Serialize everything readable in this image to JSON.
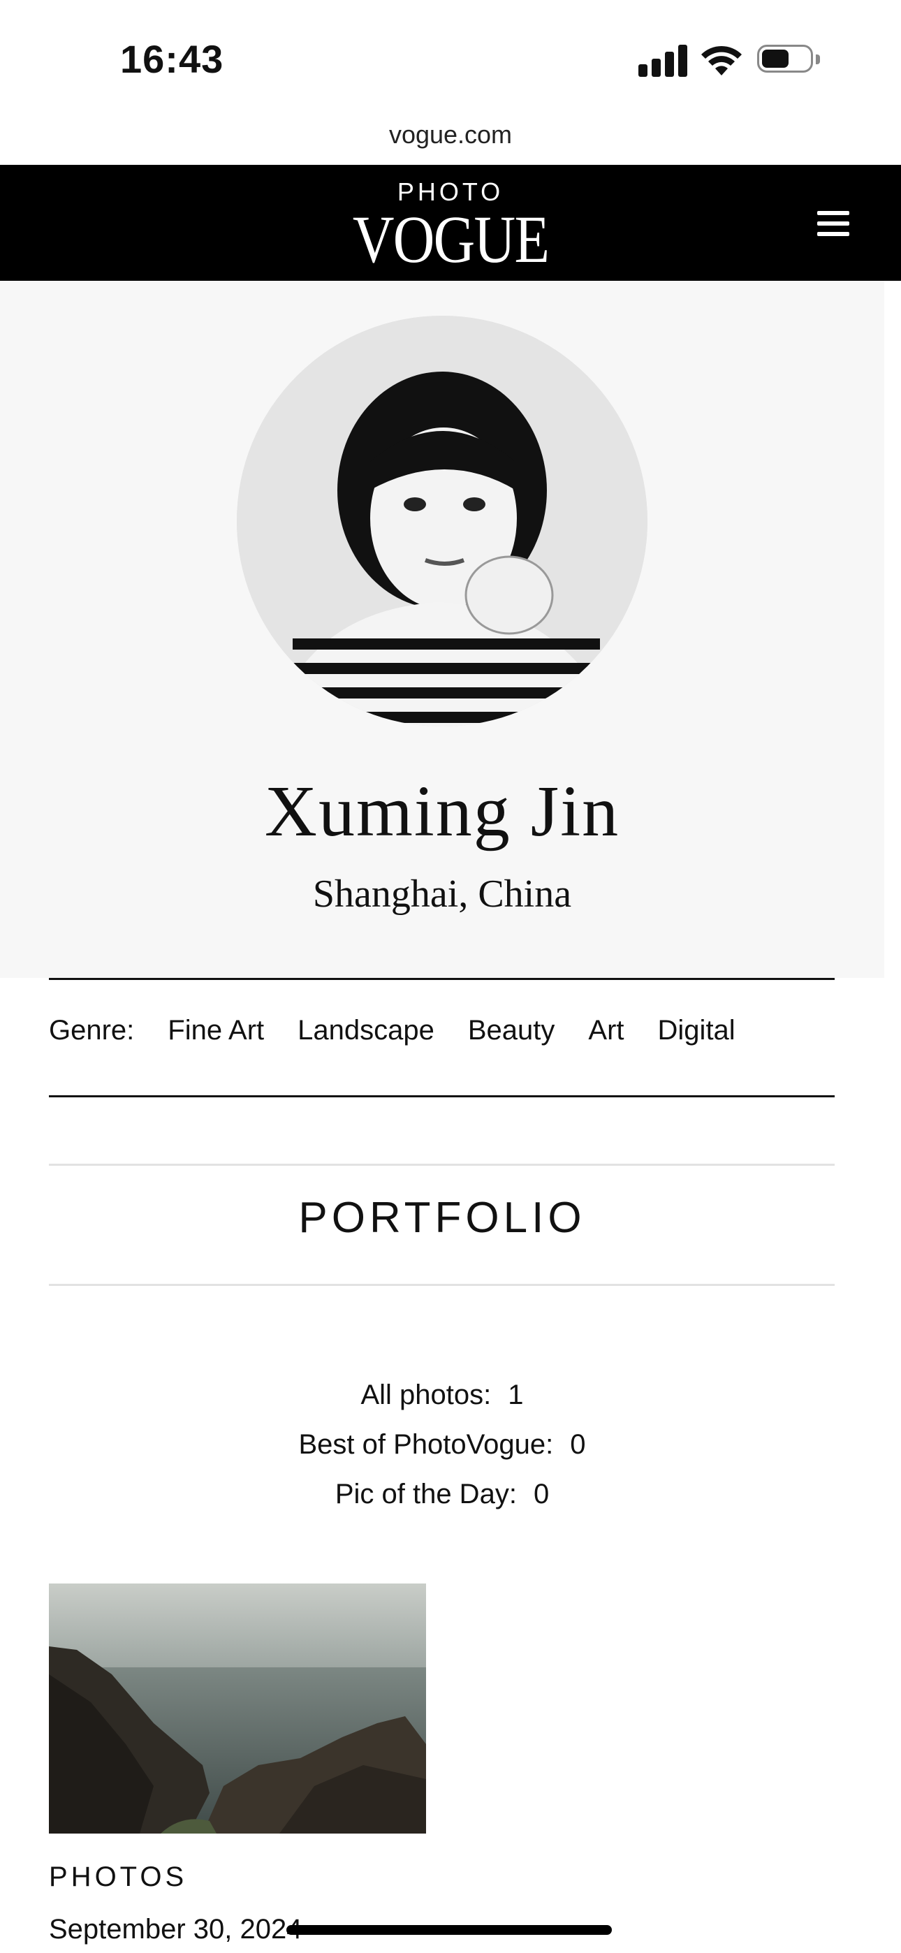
{
  "status_bar": {
    "time": "16:43",
    "icons": [
      "signal-icon",
      "wifi-icon",
      "battery-icon"
    ]
  },
  "browser": {
    "url": "vogue.com"
  },
  "header": {
    "logo_top": "PHOTO",
    "logo_main": "VOGUE",
    "menu_icon": "hamburger-menu-icon",
    "background": "#000000"
  },
  "profile": {
    "name": "Xuming Jin",
    "location": "Shanghai, China",
    "hero_background": "#f7f7f7"
  },
  "genre": {
    "label": "Genre:",
    "tags": [
      "Fine Art",
      "Landscape",
      "Beauty",
      "Art",
      "Digital"
    ]
  },
  "portfolio": {
    "title": "PORTFOLIO",
    "stats": [
      {
        "label": "All photos:",
        "value": "1"
      },
      {
        "label": "Best of PhotoVogue:",
        "value": "0"
      },
      {
        "label": "Pic of the Day:",
        "value": "0"
      }
    ],
    "photos": [
      {
        "section_label": "PHOTOS",
        "date": "September 30, 2024"
      }
    ]
  }
}
